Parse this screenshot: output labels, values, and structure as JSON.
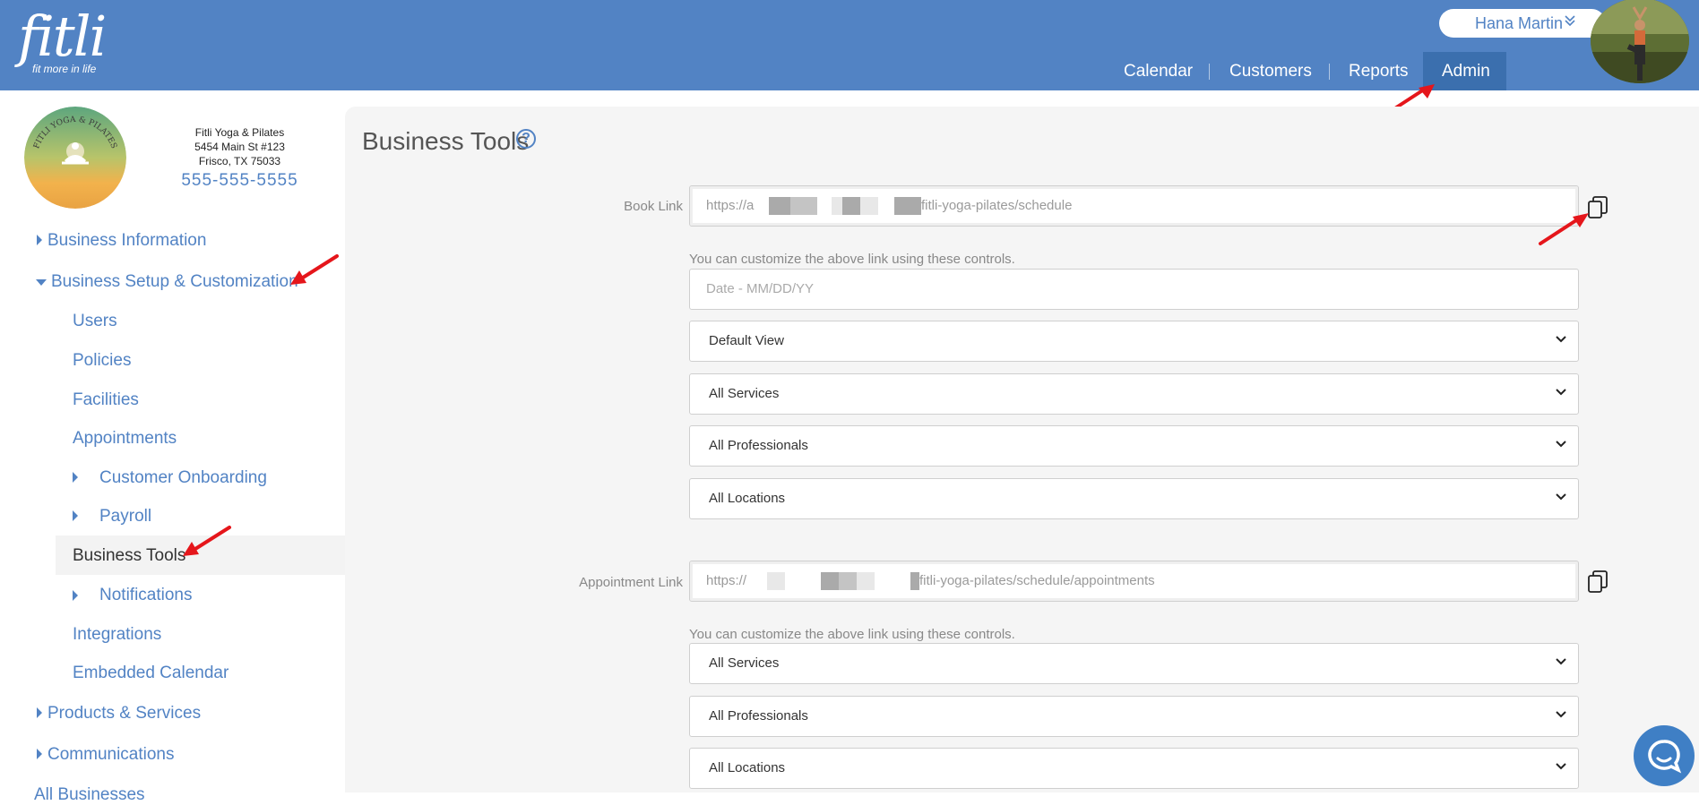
{
  "header": {
    "logo_word": "fitli",
    "logo_tagline": "fit more in life",
    "user_name": "Hana Martin",
    "nav": [
      {
        "label": "Calendar"
      },
      {
        "label": "Customers"
      },
      {
        "label": "Reports"
      },
      {
        "label": "Admin",
        "active": true
      }
    ]
  },
  "business": {
    "name": "Fitli Yoga & Pilates",
    "address1": "5454 Main St #123",
    "address2": "Frisco, TX 75033",
    "phone": "555-555-5555",
    "logo_text": "FITLI YOGA & PILATES"
  },
  "sidebar": {
    "sections": [
      {
        "label": "Business Information",
        "expanded": false
      },
      {
        "label": "Business Setup & Customization",
        "expanded": true
      },
      {
        "label": "Products & Services",
        "expanded": false
      },
      {
        "label": "Communications",
        "expanded": false
      },
      {
        "label": "All Businesses",
        "expanded": false
      }
    ],
    "sub_items": [
      {
        "label": "Users"
      },
      {
        "label": "Policies"
      },
      {
        "label": "Facilities"
      },
      {
        "label": "Appointments"
      },
      {
        "label": "Customer Onboarding",
        "has_children": true
      },
      {
        "label": "Payroll",
        "has_children": true
      },
      {
        "label": "Business Tools",
        "active": true
      },
      {
        "label": "Notifications",
        "has_children": true
      },
      {
        "label": "Integrations"
      },
      {
        "label": "Embedded Calendar"
      }
    ]
  },
  "main": {
    "title": "Business Tools",
    "book_link": {
      "label": "Book Link",
      "prefix": "https://a",
      "suffix": "fitli-yoga-pilates/schedule",
      "helper": "You can customize the above link using these controls.",
      "date_placeholder": "Date - MM/DD/YY",
      "view_select": "Default View",
      "services_select": "All Services",
      "professionals_select": "All Professionals",
      "locations_select": "All Locations"
    },
    "appointment_link": {
      "label": "Appointment Link",
      "prefix": "https://",
      "suffix": "fitli-yoga-pilates/schedule/appointments",
      "helper": "You can customize the above link using these controls.",
      "services_select": "All Services",
      "professionals_select": "All Professionals",
      "locations_select": "All Locations"
    }
  },
  "colors": {
    "brand_blue": "#5283c4",
    "nav_active": "#3b6fae",
    "annotation_red": "#e5161b",
    "chat_blue": "#3f7fc5"
  },
  "icons": [
    "help-icon",
    "copy-icon",
    "chevron-down-icon",
    "chat-icon",
    "caret-right-icon",
    "caret-down-icon"
  ]
}
